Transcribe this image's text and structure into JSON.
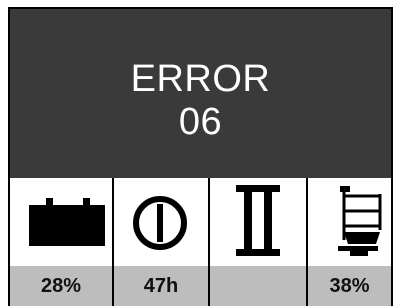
{
  "display": {
    "error_title": "ERROR",
    "error_code": "06"
  },
  "indicators": [
    {
      "icon": "battery-icon",
      "value": "28%"
    },
    {
      "icon": "power-icon",
      "value": "47h"
    },
    {
      "icon": "mast-icon",
      "value": ""
    },
    {
      "icon": "fork-lift-icon",
      "value": "38%"
    }
  ],
  "colors": {
    "panel_background": "#3a3a3a",
    "footer_background": "#bdbdbd",
    "text_light": "#ffffff"
  }
}
